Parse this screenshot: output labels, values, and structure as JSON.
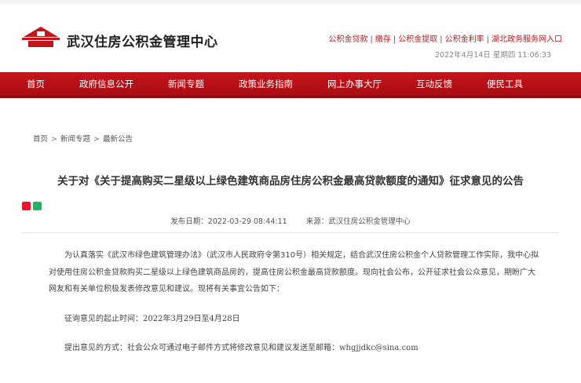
{
  "site": {
    "title": "武汉住房公积金管理中心",
    "datetime": "2022年4月14日 星期四 11:06:33",
    "quick_links": [
      "公积金贷款",
      "缴存",
      "公积金提取",
      "公积金利率",
      "湖北政务服务网入口"
    ]
  },
  "nav": [
    "首页",
    "政府信息公开",
    "新闻专题",
    "政策业务指南",
    "网上办事大厅",
    "互动反馈",
    "便民工具"
  ],
  "breadcrumb": [
    "首页",
    "新闻专题",
    "最新公告"
  ],
  "article": {
    "title": "关于对《关于提高购买二星级以上绿色建筑商品房住房公积金最高贷款额度的通知》征求意见的公告",
    "publish_label": "发布日期：",
    "publish_date": "2022-03-29 08:44:11",
    "source_label": "来源：",
    "source": "武汉住房公积金管理中心",
    "paragraph": "为认真落实《武汉市绿色建筑管理办法》（武汉市人民政府令第310号）相关规定，结合武汉住房公积金个人贷款管理工作实际，我中心拟对使用住房公积金贷款购买二星级以上绿色建筑商品房的，提高住房公积金最高贷款额度。现向社会公布，公开征求社会公众意见，期盼广大网友和有关单位积极发表修改意见和建议。现将有关事宜公告如下：",
    "period_label": "征询意见的起止时间：",
    "period_value": "2022年3月29日至4月28日",
    "method_label": "提出意见的方式：社会公众可通过电子邮件方式将修改意见和建议发送至邮箱：",
    "email": "whgjjdkc@sina.com"
  },
  "colors": {
    "brand_red": "#c4141b",
    "nav_red": "#b5101a"
  },
  "icons": [
    "logo-house-icon",
    "weibo-share-icon",
    "wechat-share-icon"
  ]
}
